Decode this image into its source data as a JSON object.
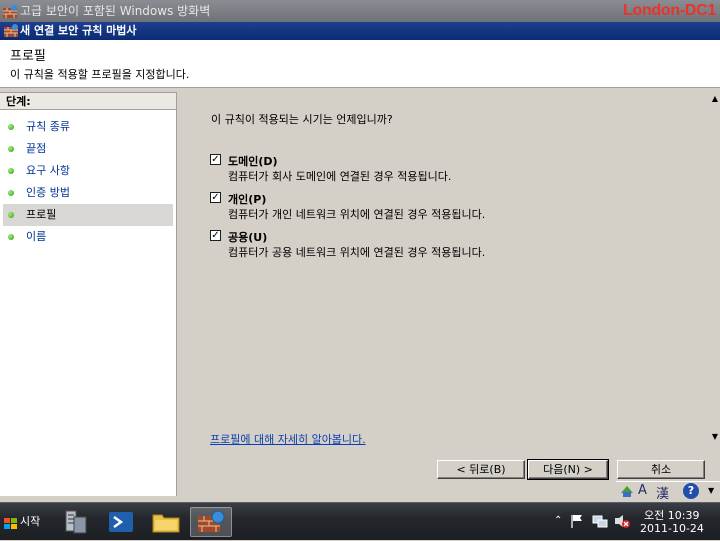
{
  "outer_window": {
    "title": "고급 보안이 포함된 Windows 방화벽",
    "host_label": "London-DC1"
  },
  "wizard": {
    "title": "새 연결 보안 규칙 마법사",
    "header": {
      "title": "프로필",
      "description": "이 규칙을 적용할 프로필을 지정합니다."
    },
    "steps_header": "단계:",
    "steps": [
      {
        "label": "규칙 종류"
      },
      {
        "label": "끝점"
      },
      {
        "label": "요구 사항"
      },
      {
        "label": "인증 방법"
      },
      {
        "label": "프로필"
      },
      {
        "label": "이름"
      }
    ],
    "current_step_index": 4,
    "question": "이 규칙이 적용되는 시기는 언제입니까?",
    "profiles": [
      {
        "label": "도메인(D)",
        "description": "컴퓨터가 회사 도메인에 연결된 경우 적용됩니다.",
        "checked": true
      },
      {
        "label": "개인(P)",
        "description": "컴퓨터가 개인 네트워크 위치에 연결된 경우 적용됩니다.",
        "checked": true
      },
      {
        "label": "공용(U)",
        "description": "컴퓨터가 공용 네트워크 위치에 연결된 경우 적용됩니다.",
        "checked": true
      }
    ],
    "learn_more_link": "프로필에 대해 자세히 알아봅니다.",
    "buttons": {
      "back": "< 뒤로(B)",
      "next": "다음(N) >",
      "cancel": "취소"
    }
  },
  "language_bar": {
    "mode_glyph": "A",
    "hanja_glyph": "漢",
    "help_glyph": "?"
  },
  "taskbar": {
    "start_label": "시작",
    "clock": {
      "time": "오전 10:39",
      "date": "2011-10-24"
    }
  },
  "colors": {
    "title_active": "#0b2b74",
    "link": "#0b3fb0",
    "host_label": "#e8342a",
    "step_dot": "#2f9a13"
  },
  "icons": [
    "firewall-icon",
    "checkbox-checked-icon",
    "green-dot-icon",
    "scroll-up-icon",
    "scroll-down-icon",
    "windows-flag-icon",
    "server-manager-icon",
    "powershell-icon",
    "explorer-icon",
    "flag-icon",
    "network-icon",
    "volume-muted-icon"
  ]
}
